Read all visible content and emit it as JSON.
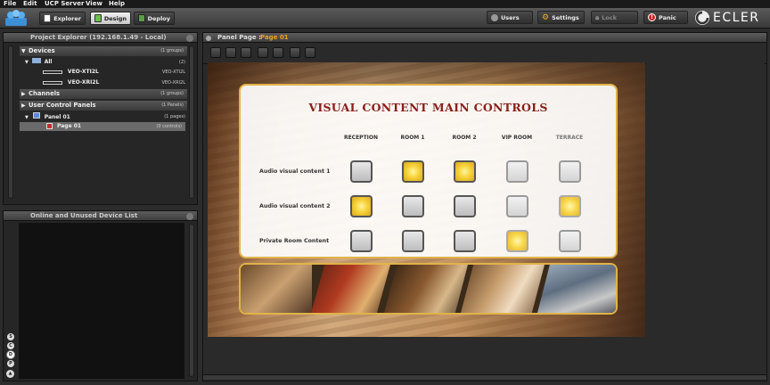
{
  "menu": [
    "File",
    "Edit",
    "UCP Server",
    "View",
    "Help"
  ],
  "toolbar": {
    "explorer": "Explorer",
    "design": "Design",
    "deploy": "Deploy",
    "users": "Users",
    "settings": "Settings",
    "lock": "Lock",
    "panic": "Panic",
    "brand": "ECLER"
  },
  "project_explorer": {
    "title": "Project Explorer (192.168.1.49 - Local)",
    "devices": {
      "label": "Devices",
      "count": "(1 groups)"
    },
    "all": {
      "label": "All",
      "count": "(2)"
    },
    "device_items": [
      {
        "label": "VEO-XTI2L",
        "model": "VEO-XTI2L"
      },
      {
        "label": "VEO-XRI2L",
        "model": "VEO-XRI2L"
      }
    ],
    "channels": {
      "label": "Channels",
      "count": "(1 groups)"
    },
    "ucp": {
      "label": "User Control Panels",
      "count": "(1 Panels)"
    },
    "panel": {
      "label": "Panel 01",
      "count": "(1 pages)"
    },
    "page": {
      "label": "Page 01",
      "count": "(0 controls)"
    }
  },
  "online_list": {
    "title": "Online and Unused Device List"
  },
  "side_buttons": [
    "S",
    "C",
    "D",
    "P"
  ],
  "panel_page": {
    "label": "Panel Page :",
    "value": "Page 01"
  },
  "controls": {
    "title": "VISUAL CONTENT MAIN CONTROLS",
    "columns": [
      "RECEPTION",
      "ROOM 1",
      "ROOM 2",
      "VIP ROOM",
      "TERRACE"
    ],
    "rows": [
      {
        "label": "Audio visual content 1",
        "states": [
          false,
          true,
          true,
          false,
          false
        ]
      },
      {
        "label": "Audio visual content 2",
        "states": [
          true,
          false,
          false,
          false,
          true
        ]
      },
      {
        "label": "Private Room Content",
        "states": [
          false,
          false,
          false,
          true,
          false
        ]
      }
    ]
  },
  "colors": {
    "accent_gold": "#e0b34a",
    "title_red": "#8a1f1a",
    "panel_page_value": "#f0a020",
    "panic_red": "#d62020"
  }
}
